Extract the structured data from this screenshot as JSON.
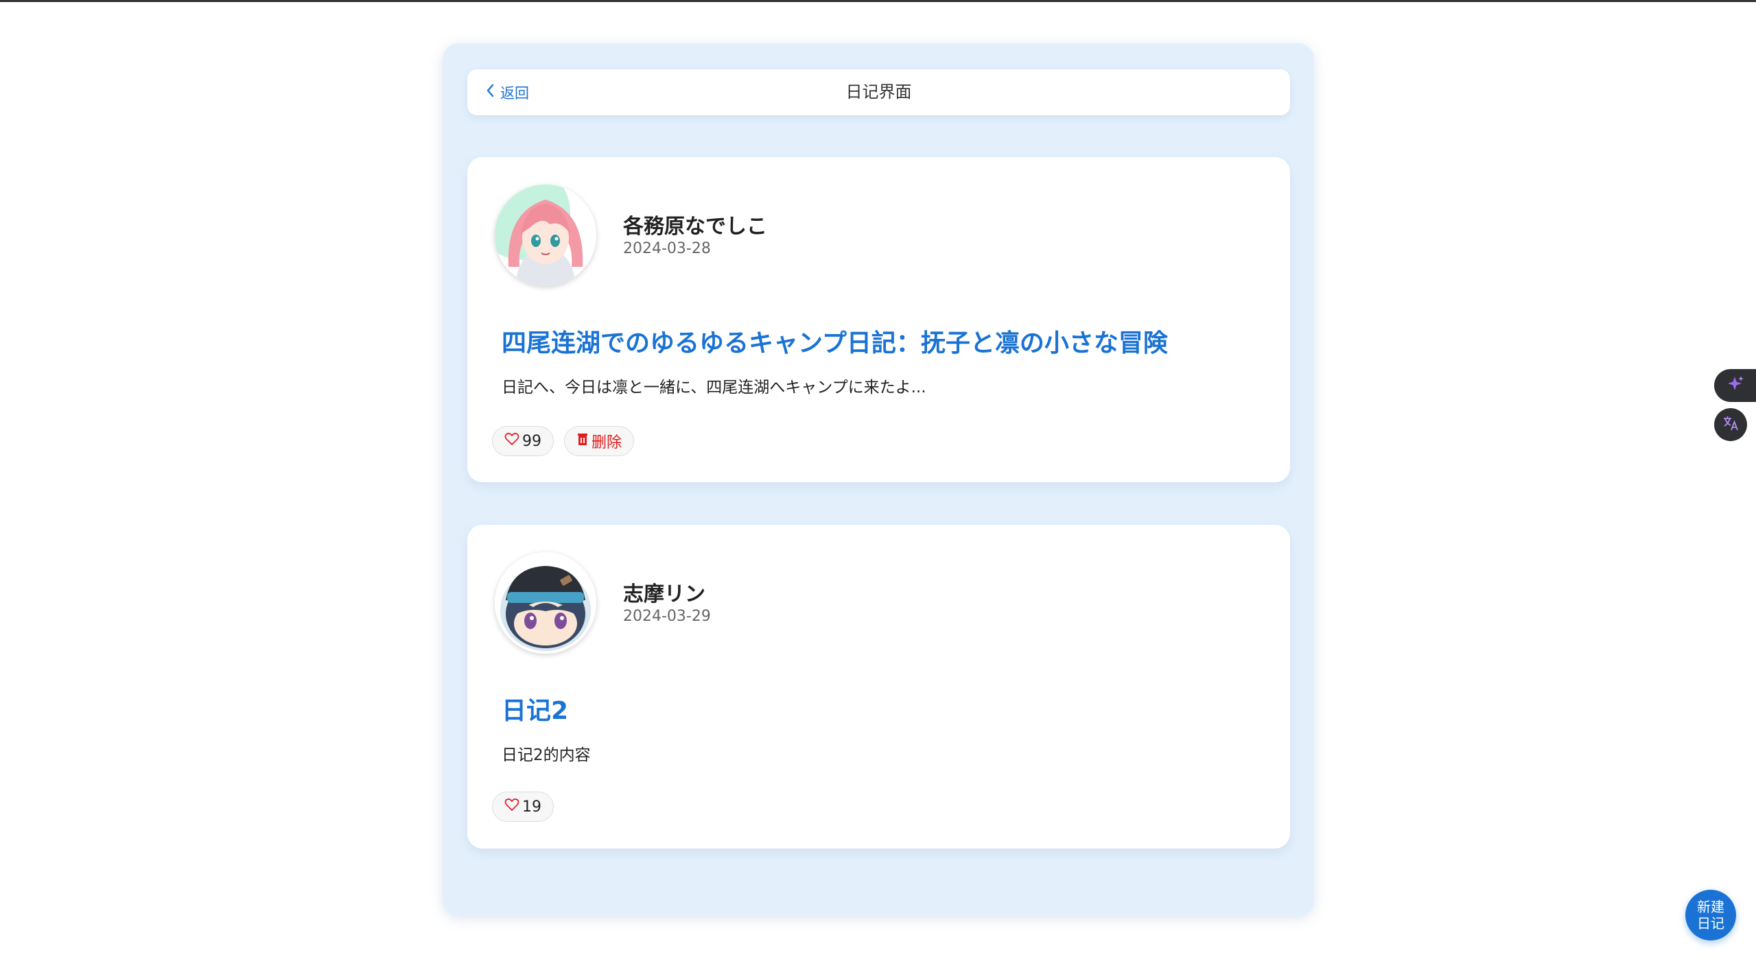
{
  "nav": {
    "back_label": "返回",
    "title": "日记界面"
  },
  "diaries": [
    {
      "author": "各務原なでしこ",
      "date": "2024-03-28",
      "title": "四尾连湖でのゆるゆるキャンプ日記：抚子と凛の小さな冒険",
      "excerpt": "日記へ、今日は凛と一緒に、四尾连湖へキャンプに来たよ...",
      "likes": "99",
      "delete_label": "删除"
    },
    {
      "author": "志摩リン",
      "date": "2024-03-29",
      "title": "日记2",
      "excerpt": "日记2的内容",
      "likes": "19"
    }
  ],
  "fab": {
    "line1": "新建",
    "line2": "日记"
  },
  "colors": {
    "accent": "#1a73d4",
    "panel_bg": "#e3f0fc",
    "delete": "#e01b1b",
    "heart": "#e0242c"
  },
  "icons": {
    "back": "chevron-left-icon",
    "like": "heart-outline-icon",
    "delete": "trash-icon",
    "ai": "sparkle-icon",
    "translate": "translate-icon"
  }
}
